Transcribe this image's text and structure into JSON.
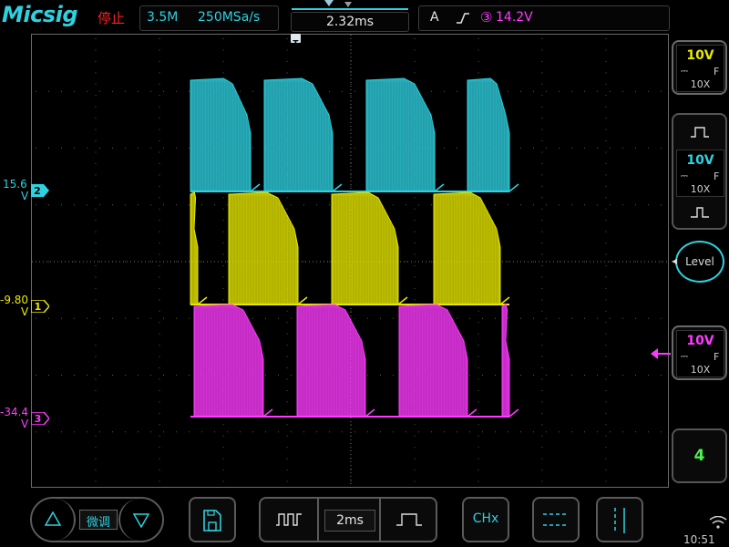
{
  "topbar": {
    "brand": "Micsig",
    "run_state": "停止",
    "memory_depth": "3.5M",
    "sample_rate": "250MSa/s",
    "time_offset": "2.32ms",
    "trigger_source": "A",
    "trigger_channel_num": "③",
    "trigger_level": "14.2V"
  },
  "channels": {
    "ch2": {
      "offset_value": "15.6",
      "unit": "V",
      "marker": "2",
      "color": "#2ed1e0"
    },
    "ch1": {
      "offset_value": "-9.80",
      "unit": "V",
      "marker": "1",
      "color": "#e8e800"
    },
    "ch3": {
      "offset_value": "-34.4",
      "unit": "V",
      "marker": "3",
      "color": "#ff3aff"
    }
  },
  "right_panel": {
    "ch_a": {
      "volts_per_div": "10V",
      "coupling_label": "F",
      "probe": "10X",
      "color": "#e8e800"
    },
    "ch_b": {
      "volts_per_div": "10V",
      "coupling_label": "F",
      "probe": "10X",
      "color": "#2ed1e0"
    },
    "level_label": "Level",
    "ch_c": {
      "volts_per_div": "10V",
      "coupling_label": "F",
      "probe": "10X",
      "color": "#ff3aff"
    },
    "active_channel_count": "4"
  },
  "bottom": {
    "fine_label": "微调",
    "timebase": "2ms",
    "channel_button": "CHx",
    "clock": "10:51"
  }
}
